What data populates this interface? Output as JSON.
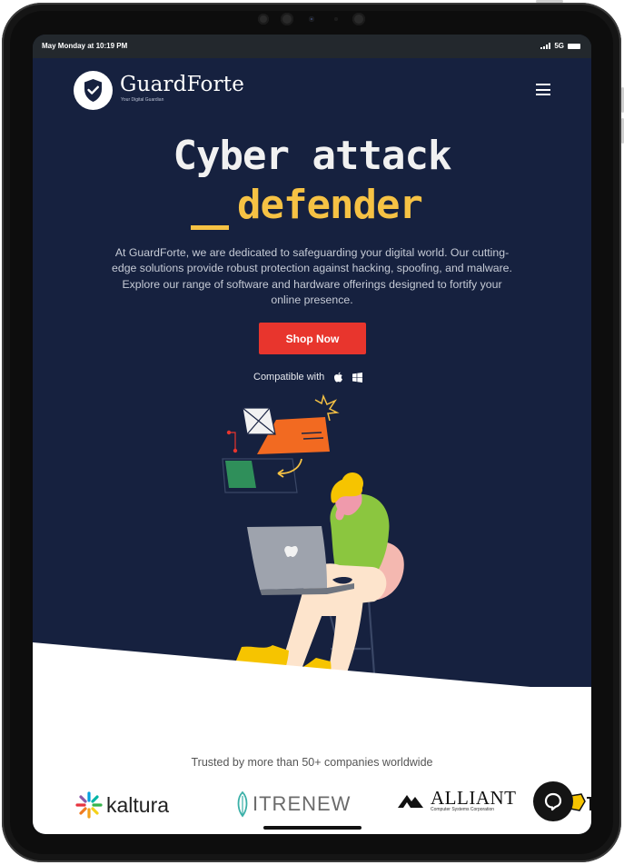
{
  "status_bar": {
    "time": "May Monday at 10:19 PM",
    "network": "5G"
  },
  "header": {
    "brand": "GuardForte",
    "tagline": "Your Digital Guardian",
    "menu_icon": "hamburger-icon"
  },
  "hero": {
    "headline_line1": "Cyber attack",
    "headline_line2": "defender",
    "description": "At GuardForte, we are dedicated to safeguarding your digital world. Our cutting-edge solutions provide robust protection against hacking, spoofing, and malware. Explore our range of software and hardware offerings designed to fortify your online presence.",
    "cta_label": "Shop Now",
    "compatible_label": "Compatible with",
    "platform_icons": [
      "apple-icon",
      "windows-icon"
    ]
  },
  "trusted": {
    "text": "Trusted by more than 50+ companies worldwide",
    "companies": [
      {
        "name": "kaltura"
      },
      {
        "name": "ITRENEW"
      },
      {
        "name": "ALLIANT",
        "subtitle": "Computer Systems Corporation"
      }
    ]
  },
  "colors": {
    "hero_bg": "#16213f",
    "accent_yellow": "#f6c244",
    "cta_red": "#e8352d",
    "status_bar_bg": "#23282d"
  }
}
